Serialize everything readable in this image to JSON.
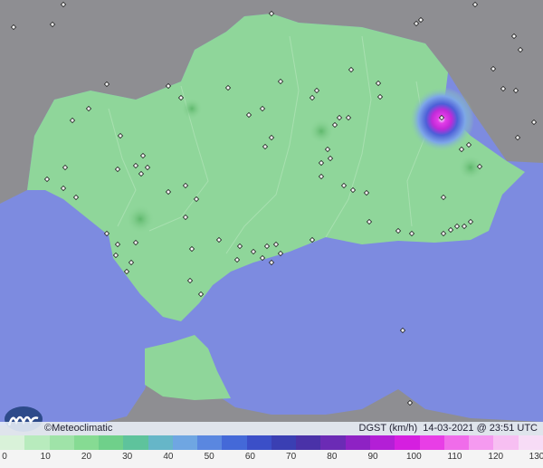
{
  "footer": {
    "brand": "Meteoclimatic",
    "copyright_symbol": "©",
    "variable": "DGST",
    "unit": "(km/h)",
    "timestamp": "14-03-2021 @ 23:51 UTC"
  },
  "scale": {
    "ticks": [
      "0",
      "10",
      "20",
      "30",
      "40",
      "50",
      "60",
      "70",
      "80",
      "90",
      "100",
      "110",
      "120",
      "130"
    ],
    "colors": [
      "#d9f2d9",
      "#b8ebbd",
      "#9fe3a8",
      "#86db93",
      "#6fd08a",
      "#5ec39c",
      "#66b6c8",
      "#6fa6e2",
      "#5a87e0",
      "#4469d8",
      "#3b4fc8",
      "#3a3fb3",
      "#4a32a8",
      "#6b2bb5",
      "#8e22c4",
      "#b31fd6",
      "#d51fe0",
      "#e83ee6",
      "#f06cea",
      "#f59af0",
      "#f7bff2",
      "#f7dcf6"
    ]
  }
}
